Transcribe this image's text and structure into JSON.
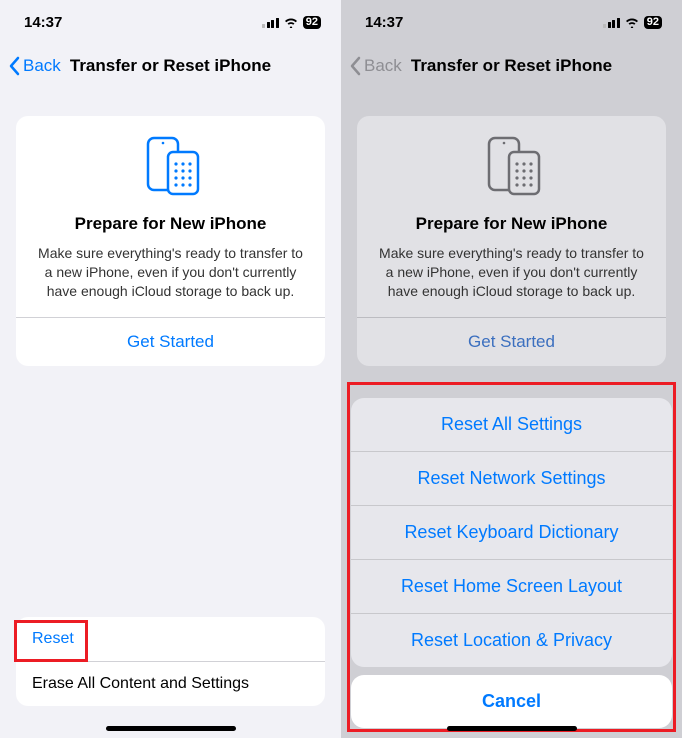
{
  "status": {
    "time": "14:37",
    "battery": "92"
  },
  "nav": {
    "back": "Back",
    "title": "Transfer or Reset iPhone"
  },
  "card": {
    "title": "Prepare for New iPhone",
    "body": "Make sure everything's ready to transfer to a new iPhone, even if you don't currently have enough iCloud storage to back up.",
    "button": "Get Started"
  },
  "bottom_list": {
    "reset": "Reset",
    "erase": "Erase All Content and Settings"
  },
  "action_sheet": {
    "items": [
      "Reset All Settings",
      "Reset Network Settings",
      "Reset Keyboard Dictionary",
      "Reset Home Screen Layout",
      "Reset Location & Privacy"
    ],
    "cancel": "Cancel"
  },
  "colors": {
    "accent": "#007aff",
    "highlight": "#ec1c24"
  }
}
